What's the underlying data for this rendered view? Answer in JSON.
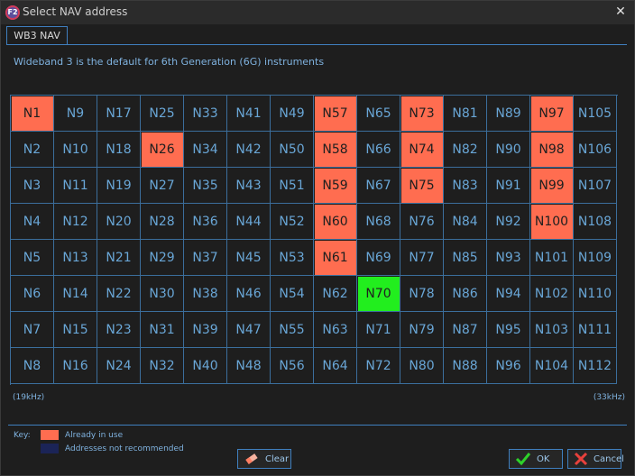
{
  "window": {
    "title": "Select NAV address",
    "app_icon_text": "F2",
    "close_glyph": "✕"
  },
  "tab": {
    "label": "WB3 NAV"
  },
  "info_text": "Wideband 3 is the default for 6th Generation (6G) instruments",
  "grid": {
    "columns": [
      [
        "N1",
        "N2",
        "N3",
        "N4",
        "N5",
        "N6",
        "N7",
        "N8"
      ],
      [
        "N9",
        "N10",
        "N11",
        "N12",
        "N13",
        "N14",
        "N15",
        "N16"
      ],
      [
        "N17",
        "N18",
        "N19",
        "N20",
        "N21",
        "N22",
        "N23",
        "N24"
      ],
      [
        "N25",
        "N26",
        "N27",
        "N28",
        "N29",
        "N30",
        "N31",
        "N32"
      ],
      [
        "N33",
        "N34",
        "N35",
        "N36",
        "N37",
        "N38",
        "N39",
        "N40"
      ],
      [
        "N41",
        "N42",
        "N43",
        "N44",
        "N45",
        "N46",
        "N47",
        "N48"
      ],
      [
        "N49",
        "N50",
        "N51",
        "N52",
        "N53",
        "N54",
        "N55",
        "N56"
      ],
      [
        "N57",
        "N58",
        "N59",
        "N60",
        "N61",
        "N62",
        "N63",
        "N64"
      ],
      [
        "N65",
        "N66",
        "N67",
        "N68",
        "N69",
        "N70",
        "N71",
        "N72"
      ],
      [
        "N73",
        "N74",
        "N75",
        "N76",
        "N77",
        "N78",
        "N79",
        "N80"
      ],
      [
        "N81",
        "N82",
        "N83",
        "N84",
        "N85",
        "N86",
        "N87",
        "N88"
      ],
      [
        "N89",
        "N90",
        "N91",
        "N92",
        "N93",
        "N94",
        "N95",
        "N96"
      ],
      [
        "N97",
        "N98",
        "N99",
        "N100",
        "N101",
        "N102",
        "N103",
        "N104"
      ],
      [
        "N105",
        "N106",
        "N107",
        "N108",
        "N109",
        "N110",
        "N111",
        "N112"
      ]
    ],
    "in_use": [
      "N1",
      "N26",
      "N57",
      "N58",
      "N59",
      "N60",
      "N61",
      "N73",
      "N74",
      "N75",
      "N97",
      "N98",
      "N99",
      "N100"
    ],
    "selected": "N70"
  },
  "freq": {
    "low": "(19kHz)",
    "high": "(33kHz)"
  },
  "key": {
    "label": "Key:",
    "in_use_text": "Already in use",
    "not_recommended_text": "Addresses not recommended",
    "in_use_color": "#ff6d50",
    "not_recommended_color": "#1b2457"
  },
  "buttons": {
    "clear": "Clear",
    "ok": "OK",
    "cancel": "Cancel"
  },
  "colors": {
    "accent": "#3f7fbf",
    "in_use": "#ff6d50",
    "selected": "#22ee1e",
    "text": "#69a6d6"
  },
  "icons": {
    "clear": "eraser-icon",
    "ok": "checkmark-icon",
    "cancel": "x-icon"
  }
}
